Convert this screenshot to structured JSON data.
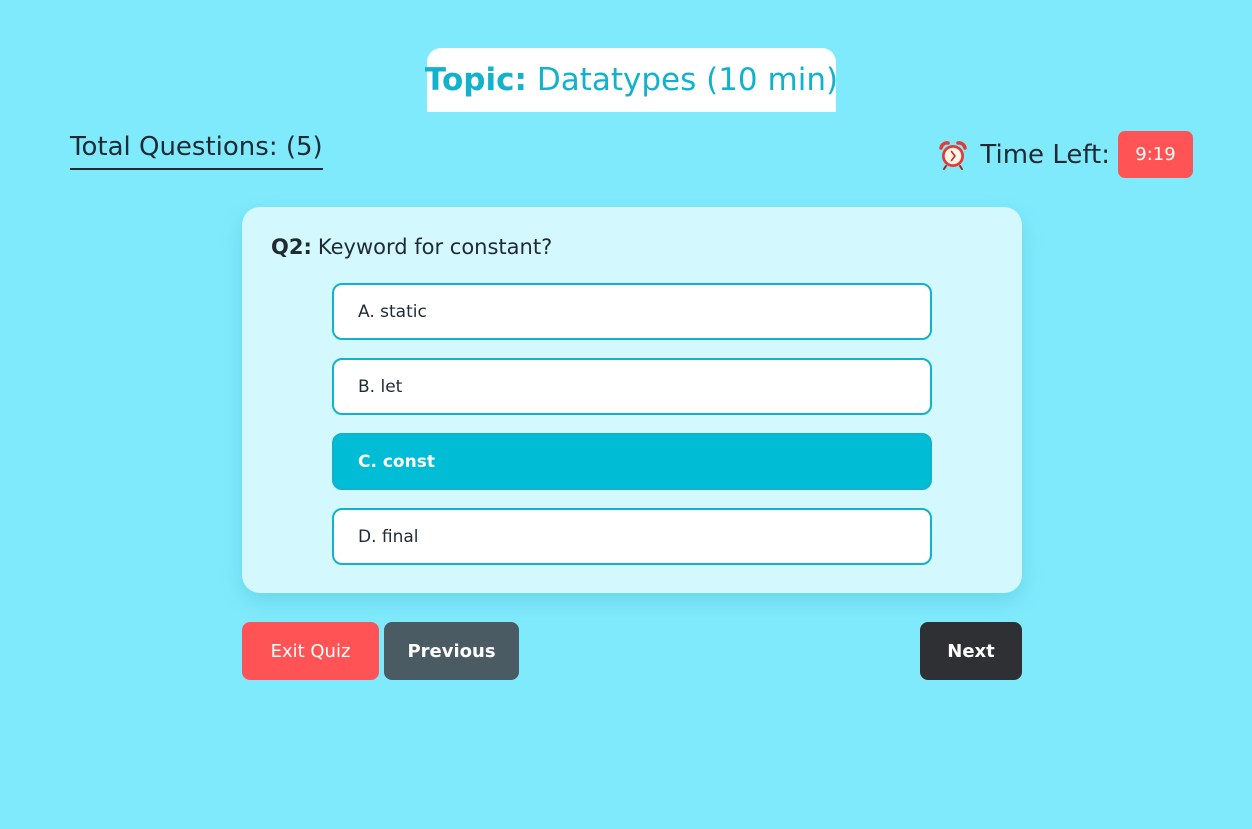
{
  "header": {
    "topic_label": "Topic:",
    "topic_value": "Datatypes (10 min)",
    "total_questions": "Total Questions: (5)",
    "timer_icon": "alarm-clock-icon",
    "timer_label": "Time Left:",
    "timer_value": "9:19"
  },
  "question": {
    "number": "Q2:",
    "text": "Keyword for constant?",
    "options": [
      {
        "label": "A. static",
        "selected": false
      },
      {
        "label": "B. let",
        "selected": false
      },
      {
        "label": "C. const",
        "selected": true
      },
      {
        "label": "D. final",
        "selected": false
      }
    ]
  },
  "buttons": {
    "exit": "Exit Quiz",
    "previous": "Previous",
    "next": "Next"
  },
  "colors": {
    "background": "#80eafd",
    "accent": "#12b2cc",
    "selected": "#00bcd4",
    "danger": "#ff5356",
    "secondary": "#4b5b63",
    "dark": "#2f3033"
  }
}
